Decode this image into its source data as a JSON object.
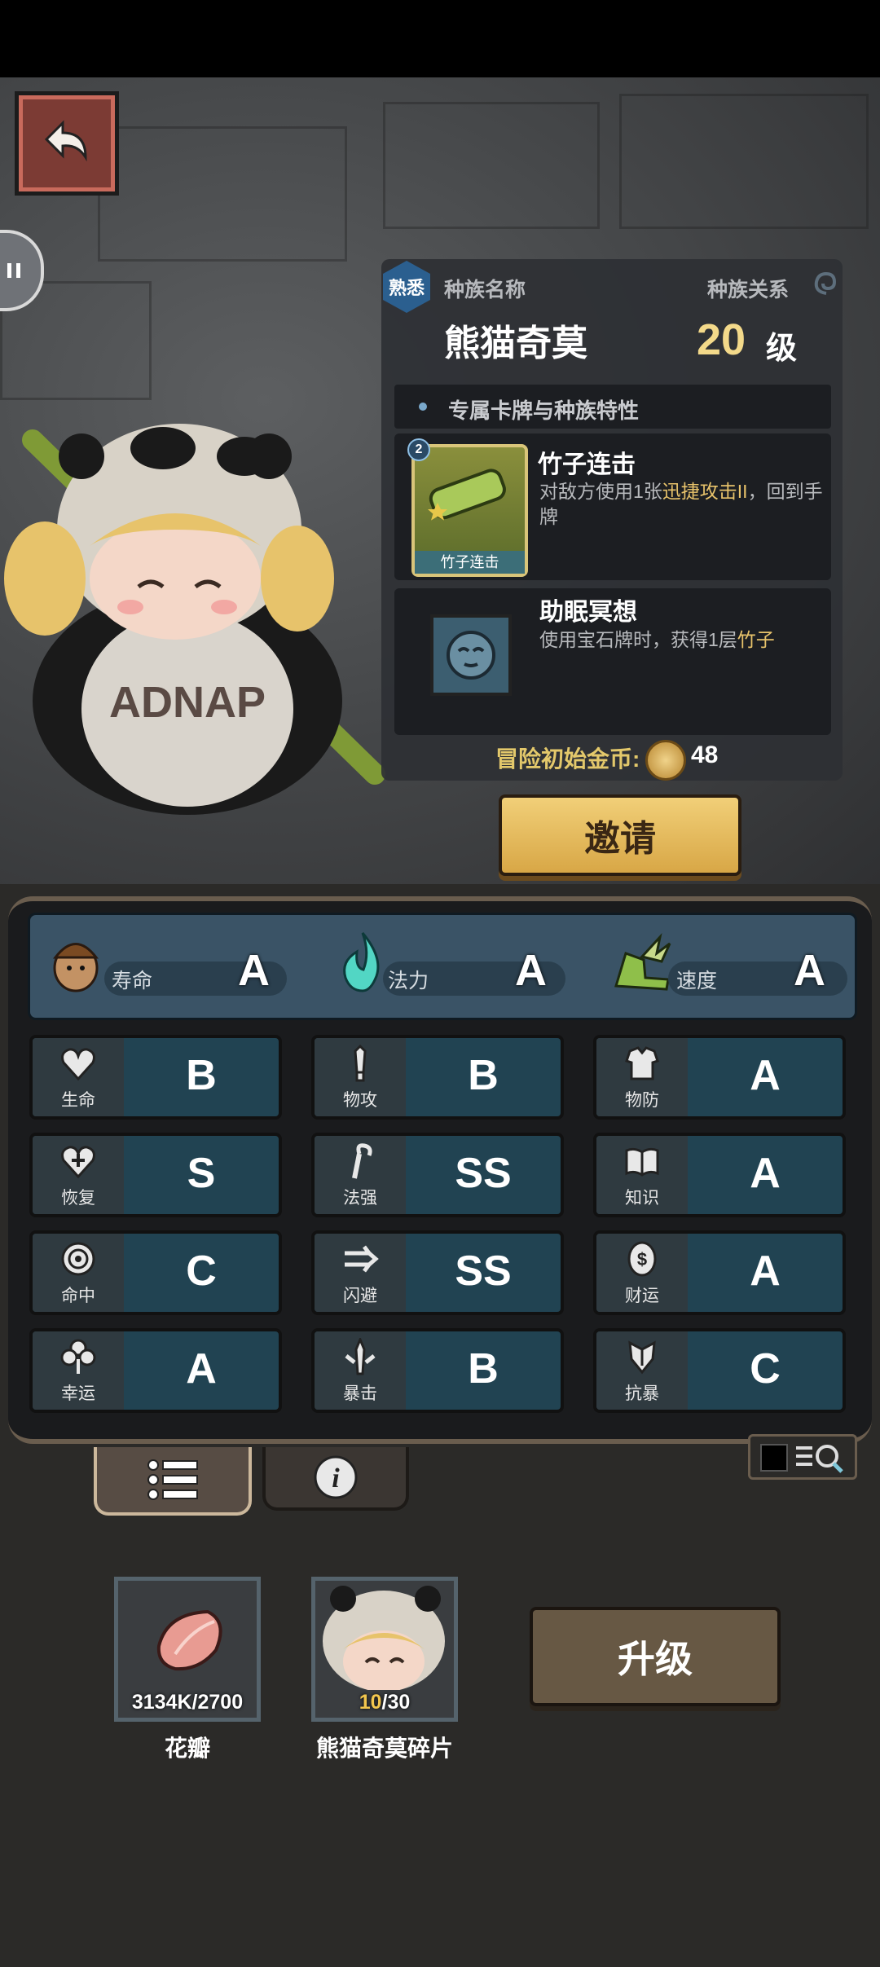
{
  "race": {
    "familiarity_badge": "熟悉",
    "name_label": "种族名称",
    "relation_label": "种族关系",
    "name": "熊猫奇莫",
    "level": "20",
    "level_unit": "级"
  },
  "traits_header": "专属卡牌与种族特性",
  "skills": [
    {
      "card_level": "2",
      "card_caption": "竹子连击",
      "title": "竹子连击",
      "desc_pre": "对敌方使用1张",
      "desc_hl": "迅捷攻击II",
      "desc_post": "，回到手牌"
    },
    {
      "title": "助眠冥想",
      "desc_pre": "使用宝石牌时，获得1层",
      "desc_hl": "竹子",
      "desc_post": ""
    }
  ],
  "start_gold_label": "冒险初始金币:",
  "start_gold": "48",
  "invite_label": "邀请",
  "top_attributes": [
    {
      "label": "寿命",
      "grade": "A",
      "icon": "chestnut-head-icon"
    },
    {
      "label": "法力",
      "grade": "A",
      "icon": "blue-flame-icon"
    },
    {
      "label": "速度",
      "grade": "A",
      "icon": "winged-boot-icon"
    }
  ],
  "stats": [
    {
      "label": "生命",
      "grade": "B",
      "icon": "heart-icon"
    },
    {
      "label": "物攻",
      "grade": "B",
      "icon": "sword-icon"
    },
    {
      "label": "物防",
      "grade": "A",
      "icon": "armor-icon"
    },
    {
      "label": "恢复",
      "grade": "S",
      "icon": "heart-plus-icon"
    },
    {
      "label": "法强",
      "grade": "SS",
      "icon": "staff-icon"
    },
    {
      "label": "知识",
      "grade": "A",
      "icon": "book-icon"
    },
    {
      "label": "命中",
      "grade": "C",
      "icon": "target-icon"
    },
    {
      "label": "闪避",
      "grade": "SS",
      "icon": "dodge-arrows-icon"
    },
    {
      "label": "财运",
      "grade": "A",
      "icon": "coin-icon"
    },
    {
      "label": "幸运",
      "grade": "A",
      "icon": "clover-icon"
    },
    {
      "label": "暴击",
      "grade": "B",
      "icon": "crit-icon"
    },
    {
      "label": "抗暴",
      "grade": "C",
      "icon": "shield-burst-icon"
    }
  ],
  "materials": [
    {
      "name": "花瓣",
      "count": "3134K/2700"
    },
    {
      "name": "熊猫奇莫碎片",
      "count_have": "10",
      "count_need": "/30"
    }
  ],
  "upgrade_label": "升级",
  "colors": {
    "gold": "#e3c86b",
    "highlight": "#e8c36b",
    "stat_bg": "#214352"
  }
}
